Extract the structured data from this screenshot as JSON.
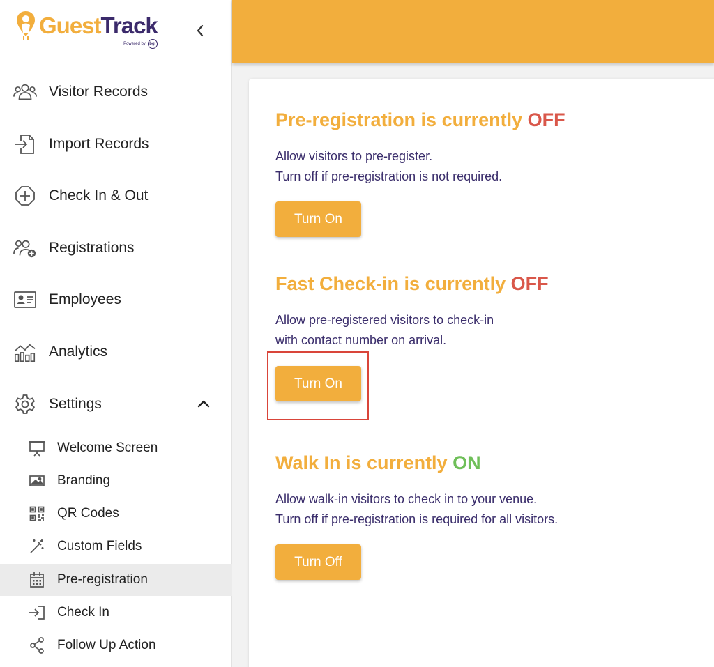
{
  "brand": {
    "name_part1": "Guest",
    "name_part2": "Track",
    "powered_by": "Powered by",
    "powered_mark": "bgl",
    "logo_icon": "person-pin-icon",
    "accent_color": "#F2AE3D",
    "brand_dark": "#3b2a6b"
  },
  "sidebar": {
    "collapse_icon": "chevron-left-icon",
    "items": [
      {
        "label": "Visitor Records",
        "icon": "people-group-icon"
      },
      {
        "label": "Import Records",
        "icon": "file-import-icon"
      },
      {
        "label": "Check In & Out",
        "icon": "plus-circle-icon"
      },
      {
        "label": "Registrations",
        "icon": "person-add-icon"
      },
      {
        "label": "Employees",
        "icon": "id-card-icon"
      },
      {
        "label": "Analytics",
        "icon": "bar-chart-icon"
      },
      {
        "label": "Settings",
        "icon": "gear-icon",
        "expanded": true
      }
    ],
    "settings_sub": [
      {
        "label": "Welcome Screen",
        "icon": "presentation-icon"
      },
      {
        "label": "Branding",
        "icon": "image-icon"
      },
      {
        "label": "QR Codes",
        "icon": "qr-code-icon"
      },
      {
        "label": "Custom Fields",
        "icon": "magic-wand-icon"
      },
      {
        "label": "Pre-registration",
        "icon": "calendar-icon",
        "active": true
      },
      {
        "label": "Check In",
        "icon": "sign-in-icon"
      },
      {
        "label": "Follow Up Action",
        "icon": "share-icon"
      }
    ]
  },
  "main": {
    "sections": [
      {
        "title_prefix": "Pre-registration is currently ",
        "state": "OFF",
        "desc_line1": "Allow visitors to pre-register.",
        "desc_line2": "Turn off if pre-registration is not required.",
        "button": "Turn On"
      },
      {
        "title_prefix": "Fast Check-in is currently ",
        "state": "OFF",
        "desc_line1": "Allow pre-registered visitors to check-in",
        "desc_line2": "with contact number on arrival.",
        "button": "Turn On"
      },
      {
        "title_prefix": "Walk In is currently ",
        "state": "ON",
        "desc_line1": "Allow walk-in visitors to check in to your venue.",
        "desc_line2": "Turn off if pre-registration is required for all visitors.",
        "button": "Turn Off"
      }
    ],
    "state_off_color": "#d9574a",
    "state_on_color": "#6fbf59"
  }
}
